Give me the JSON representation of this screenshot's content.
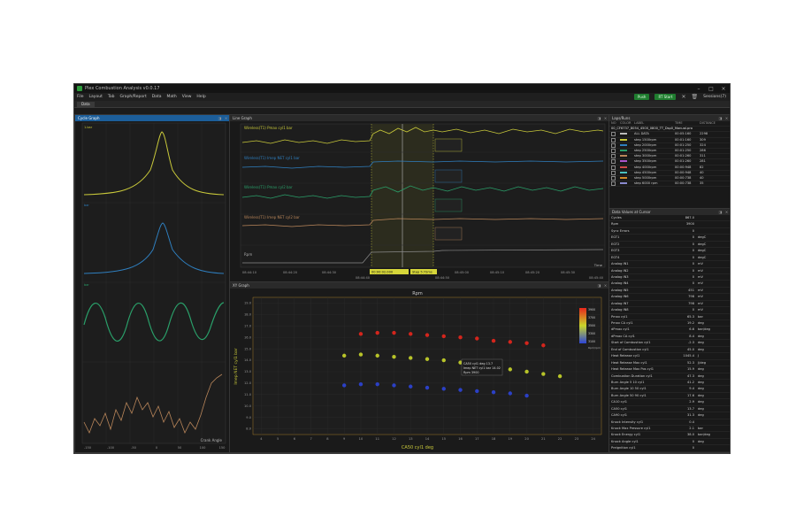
{
  "app": {
    "title": "Plex Combustion Analysis v0.0.17",
    "menu": [
      "File",
      "Layout",
      "Tab",
      "Graph/Report",
      "Data",
      "Math",
      "View",
      "Help"
    ],
    "toolbar": {
      "button1": "Push",
      "button2": "RT Start",
      "sessions_label": "Sessions(7)"
    },
    "tab_label": "Data"
  },
  "cycle_graph": {
    "title": "Cycle Graph",
    "axis_x_label": "Crank Angle",
    "x_ticks": [
      "-150",
      "-100",
      "-50",
      "0",
      "50",
      "100",
      "150"
    ],
    "trace_labels": [
      "1.bar",
      "bar",
      "bar",
      ""
    ],
    "colors": [
      "#c8c83a",
      "#2f7fbf",
      "#2aa06a",
      "#b9865a"
    ]
  },
  "line_graph": {
    "title": "Line Graph",
    "axis_x_label": "Time",
    "cursor_time": "00:00:02.000",
    "cursor_range": "Step 5:72ms",
    "trace_labels": [
      "Wireless(T1) Pmax cyl1 bar",
      "Wireless(T1) Imep NET cyl1 bar",
      "Wireless(T1) Pmax cyl2 bar",
      "Wireless(T1) Imep NET cyl2 bar",
      "Rpm"
    ],
    "x_ticks": [
      "08:44:10",
      "08:44:20",
      "08:44:30",
      "08:44:40",
      "08:44:50",
      "08:45:00",
      "08:45:10",
      "08:45:20",
      "08:45:30",
      "08:45:40"
    ],
    "colors": [
      "#c8c83a",
      "#2f7fbf",
      "#2aa06a",
      "#b9865a",
      "#8a8a8a"
    ]
  },
  "xy_graph": {
    "title": "XY Graph",
    "plot_title": "Rpm",
    "xlabel": "CA50 cyl1 deg",
    "ylabel": "Imep NET cyl1 bar",
    "x_ticks": [
      "4",
      "5",
      "6",
      "7",
      "8",
      "9",
      "10",
      "11",
      "12",
      "13",
      "14",
      "15",
      "16",
      "17",
      "18",
      "19",
      "20",
      "21",
      "22",
      "23",
      "24"
    ],
    "y_ticks": [
      "19.0",
      "18.0",
      "17.0",
      "16.0",
      "15.0",
      "14.0",
      "13.0",
      "12.0",
      "11.0",
      "10.0",
      "9.0",
      "8.0"
    ],
    "tooltip": [
      "CA50 cyl1 deg 13.7",
      "Imep NET cyl1 bar 14.02",
      "Rpm 3900"
    ],
    "legend_values": [
      "3900",
      "3700",
      "3500",
      "3300",
      "3100"
    ],
    "legend_title": "Rpm/rpm"
  },
  "chart_data": {
    "type": "scatter",
    "title": "Rpm",
    "xlabel": "CA50 cyl1 deg",
    "ylabel": "Imep NET cyl1 bar",
    "xlim": [
      3.5,
      24.5
    ],
    "ylim": [
      7.5,
      19.5
    ],
    "series": [
      {
        "name": "3900",
        "color": "#e8261c",
        "x": [
          10,
          11,
          12,
          13,
          14,
          15,
          16,
          17,
          18,
          19,
          20,
          21
        ],
        "y": [
          16.3,
          16.4,
          16.4,
          16.3,
          16.2,
          16.1,
          16.0,
          15.9,
          15.7,
          15.6,
          15.5,
          15.3
        ]
      },
      {
        "name": "3500",
        "color": "#c9d62a",
        "x": [
          9,
          10,
          11,
          12,
          13,
          14,
          15,
          16,
          17,
          18,
          19,
          20,
          21,
          22
        ],
        "y": [
          14.4,
          14.5,
          14.4,
          14.3,
          14.2,
          14.1,
          14.0,
          13.8,
          13.6,
          13.4,
          13.2,
          13.0,
          12.8,
          12.6
        ]
      },
      {
        "name": "3100",
        "color": "#2c44d8",
        "x": [
          9,
          10,
          11,
          12,
          13,
          14,
          15,
          16,
          17,
          18,
          19,
          20
        ],
        "y": [
          11.8,
          11.9,
          11.9,
          11.8,
          11.7,
          11.6,
          11.5,
          11.4,
          11.3,
          11.2,
          11.1,
          10.9
        ]
      }
    ],
    "grid": true,
    "legend_position": "top-right"
  },
  "laps": {
    "title": "Laps/Runs",
    "headers": [
      "NO",
      "COLOR",
      "LABEL",
      "TIME",
      "DISTANCE"
    ],
    "group": "00_CF6737_8054_4500_0800_TT_Dsp0_Manual.pro",
    "rows": [
      [
        "",
        "",
        "ALL DATA",
        "00:05:160",
        "2298"
      ],
      [
        "",
        "",
        "step 1500rpm",
        "00:01:160",
        "309"
      ],
      [
        "",
        "",
        "step 2000rpm",
        "00:01:250",
        "324"
      ],
      [
        "",
        "",
        "step 2500rpm",
        "00:01:250",
        "286"
      ],
      [
        "",
        "",
        "step 3000rpm",
        "00:01:260",
        "311"
      ],
      [
        "",
        "",
        "step 3500rpm",
        "00:01:260",
        "281"
      ],
      [
        "",
        "",
        "step 4000rpm",
        "00:00:948",
        "82"
      ],
      [
        "",
        "",
        "step 4500rpm",
        "00:00:948",
        "40"
      ],
      [
        "",
        "",
        "step 5000rpm",
        "00:00:738",
        "40"
      ],
      [
        "",
        "",
        "step 6000 rpm",
        "00:00:738",
        "35"
      ]
    ]
  },
  "data_values": {
    "title": "Data Values at Cursor",
    "rows": [
      [
        "Cycles",
        "867.0",
        ""
      ],
      [
        "Rpm",
        "3900",
        ""
      ],
      [
        "Sync Errors",
        "0",
        ""
      ],
      [
        "EGT1",
        "0",
        "degC"
      ],
      [
        "EGT2",
        "0",
        "degC"
      ],
      [
        "EGT3",
        "0",
        "degC"
      ],
      [
        "EGT4",
        "0",
        "degC"
      ],
      [
        "Analog IN1",
        "0",
        "mV"
      ],
      [
        "Analog IN2",
        "0",
        "mV"
      ],
      [
        "Analog IN3",
        "0",
        "mV"
      ],
      [
        "Analog IN4",
        "0",
        "mV"
      ],
      [
        "Analog IN5",
        "451",
        "mV"
      ],
      [
        "Analog IN6",
        "798",
        "mV"
      ],
      [
        "Analog IN7",
        "798",
        "mV"
      ],
      [
        "Analog IN8",
        "0",
        "mV"
      ],
      [
        "Pmax cyl1",
        "65.3",
        "bar"
      ],
      [
        "Pmax CA cyl1",
        "19.2",
        "deg"
      ],
      [
        "dPmax cyl1",
        "6.6",
        "bar/deg"
      ],
      [
        "dPmax CA cyl1",
        "8.4",
        "deg"
      ],
      [
        "Start of Combustion cyl1",
        "-2.3",
        "deg"
      ],
      [
        "End of Combustion cyl1",
        "45.0",
        "deg"
      ],
      [
        "Heat Release cyl1",
        "1045.4",
        "J"
      ],
      [
        "Heat Release Max cyl1",
        "52.3",
        "J/deg"
      ],
      [
        "Heat Release Max Pos cyl1",
        "15.9",
        "deg"
      ],
      [
        "Combustion Duration cyl1",
        "47.3",
        "deg"
      ],
      [
        "Burn Angle 5 10 cyl1",
        "41.2",
        "deg"
      ],
      [
        "Burn Angle 10 50 cyl1",
        "9.4",
        "deg"
      ],
      [
        "Burn Angle 50 90 cyl1",
        "17.6",
        "deg"
      ],
      [
        "CA10 cyl1",
        "2.9",
        "deg"
      ],
      [
        "CA50 cyl1",
        "13.7",
        "deg"
      ],
      [
        "CA90 cyl1",
        "31.3",
        "deg"
      ],
      [
        "Knock Intensity cyl1",
        "0.4",
        ""
      ],
      [
        "Knock Max Pressure cyl1",
        "2.1",
        "bar"
      ],
      [
        "Knock Energy cyl1",
        "38.0",
        "bar/deg"
      ],
      [
        "Knock Angle cyl1",
        "0",
        "deg"
      ],
      [
        "Preignition cyl1",
        "0",
        ""
      ],
      [
        "Misfire cyl1",
        "0",
        ""
      ]
    ]
  }
}
